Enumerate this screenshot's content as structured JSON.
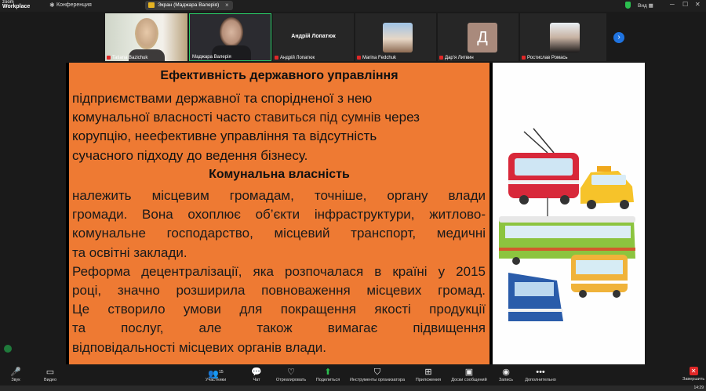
{
  "app": {
    "brand_top": "zoom",
    "brand_bottom": "Workplace",
    "conference_label": "Конференция"
  },
  "share_pill": {
    "label": "Экран (Маджара Валерія)"
  },
  "top_right": {
    "view_label": "Вид"
  },
  "participants": [
    {
      "name": "Tatiana Bazichuk",
      "muted": true
    },
    {
      "name": "Маджара Валерія",
      "muted": false,
      "active": true
    },
    {
      "name": "Андрій Лопатюк",
      "muted": true,
      "display_name": "Андрій Лопатюк"
    },
    {
      "name": "Marina Fedchuk",
      "muted": true
    },
    {
      "name": "Дар'я Литвин",
      "muted": true,
      "initial": "Д"
    },
    {
      "name": "Ростислав Ромась",
      "muted": true
    }
  ],
  "slide": {
    "heading1": "Ефективність державного управління",
    "p1_lines": [
      "підприємствами державної та спорідненої з нею",
      "комунальної власності часто ",
      "ставиться під сумнів",
      " через",
      "корупцію, неефективне управління та відсутність",
      "сучасного підходу до ведення бізнесу."
    ],
    "heading2": "Комунальна власність",
    "p2_lines": [
      "належить місцевим громадам, точніше, органу влади",
      "громади. Вона охоплює об’єкти інфраструктури, житлово-",
      "комунальне господарство, місцевий транспорт, медичні",
      "та освітні заклади."
    ],
    "p3_lines": [
      "Реформа децентралізації, яка розпочалася в країні у 2015",
      "році, значно розширила повноваження місцевих громад.",
      "Це створило умови для покращення якості продукції",
      "та послуг, але також вимагає підвищення",
      "відповідальності місцевих органів влади."
    ]
  },
  "toolbar": {
    "items": [
      {
        "label": "Звук",
        "icon": "mic-muted-icon"
      },
      {
        "label": "Видео",
        "icon": "video-icon"
      },
      {
        "label": "Участники",
        "icon": "participants-icon",
        "count": "15"
      },
      {
        "label": "Чат",
        "icon": "chat-icon"
      },
      {
        "label": "Отреагировать",
        "icon": "react-icon"
      },
      {
        "label": "Поделиться",
        "icon": "share-icon"
      },
      {
        "label": "Инструменты организатора",
        "icon": "host-tools-icon"
      },
      {
        "label": "Приложения",
        "icon": "apps-icon"
      },
      {
        "label": "Доски сообщений",
        "icon": "whiteboard-icon"
      },
      {
        "label": "Запись",
        "icon": "record-icon"
      },
      {
        "label": "Дополнительно",
        "icon": "more-icon"
      }
    ],
    "end_label": "Завершить"
  },
  "taskbar": {
    "clock": "14:29"
  },
  "colors": {
    "slide_bg": "#ee7a33",
    "accent_green": "#2bd16a",
    "accent_blue": "#1f73e0",
    "danger": "#e02828"
  }
}
